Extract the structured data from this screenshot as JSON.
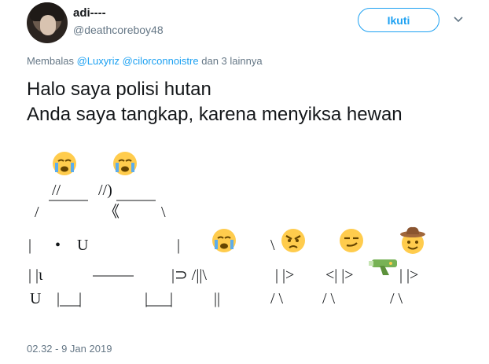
{
  "author": {
    "display_name": "adi----",
    "handle": "@deathcoreboy48"
  },
  "follow_button": {
    "label": "Ikuti"
  },
  "reply": {
    "prefix": "Membalas",
    "mentions": [
      "@Luxyriz",
      "@cilorconnoistre"
    ],
    "suffix": "dan 3 lainnya"
  },
  "tweet": {
    "line1": "Halo saya polisi hutan",
    "line2": "Anda saya tangkap, karena menyiksa hewan"
  },
  "art": {
    "r1a": "//",
    "r1b": "//)",
    "r2a": "/",
    "r2b": "《",
    "r2c": "\\",
    "r3a": "|",
    "r3b": "•",
    "r3c": "U",
    "r3d": "|",
    "r3e": "\\",
    "r4a": "| |ι",
    "r4b": "|⊃ /||\\",
    "r4c": "| |>",
    "r4d": "<| |>",
    "r4e": "| |>",
    "r5a": "U",
    "r5b": "|",
    "r5c": "|",
    "r5d": "|",
    "r5e": "|",
    "r5f": "||",
    "r5g": "/ \\",
    "r5h": "/ \\",
    "r5i": "/ \\",
    "emojis": [
      "crying-face",
      "crying-face",
      "crying-face",
      "angry-face",
      "smirking-face",
      "cowboy-face",
      "water-pistol"
    ]
  },
  "timestamp": "02.32 - 9 Jan 2019",
  "colors": {
    "accent": "#1da1f2",
    "muted": "#657786",
    "text": "#14171a"
  }
}
